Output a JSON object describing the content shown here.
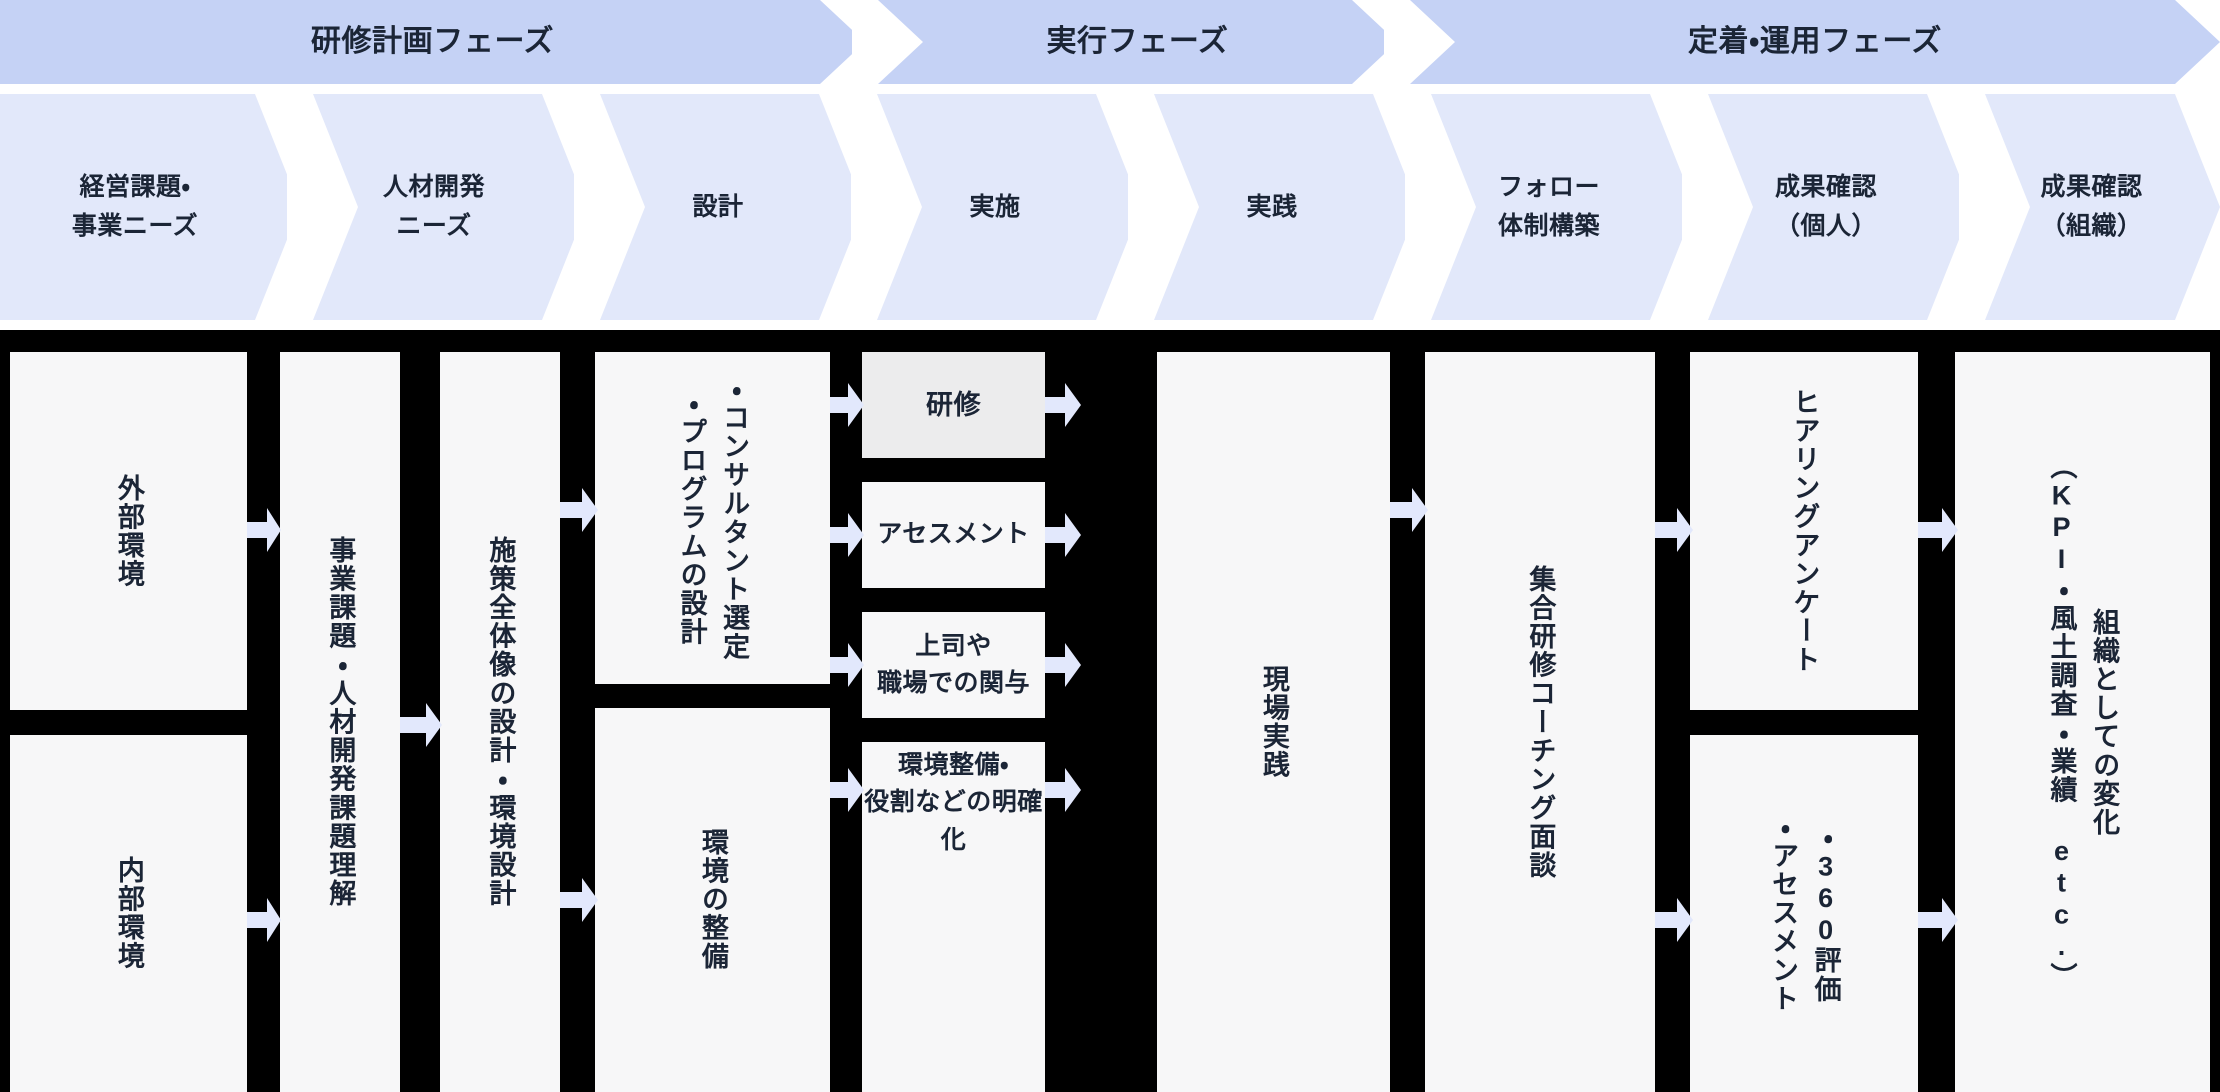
{
  "colors": {
    "phase_fill": "#c5d2f5",
    "stage_fill": "#e2e8fa",
    "separator": "#ffffff",
    "box_fill": "#f7f7f8",
    "box_fill_shaded": "#ececed",
    "body_background": "#000000",
    "arrow_fill": "#e2e8fc",
    "text": "#1b2536"
  },
  "phases": [
    {
      "label": "研修計画フェーズ"
    },
    {
      "label": "実行フェーズ"
    },
    {
      "label": "定着・運用フェーズ"
    }
  ],
  "stages": [
    {
      "label": "経営課題・\n事業ニーズ"
    },
    {
      "label": "人材開発\nニーズ"
    },
    {
      "label": "設計"
    },
    {
      "label": "実施"
    },
    {
      "label": "実践"
    },
    {
      "label": "フォロー\n体制構築"
    },
    {
      "label": "成果確認\n（個人）"
    },
    {
      "label": "成果確認\n（組織）"
    }
  ],
  "columns": [
    {
      "name": "environment",
      "boxes": [
        {
          "label": "外部環境",
          "orientation": "vertical",
          "shaded": false
        },
        {
          "label": "内部環境",
          "orientation": "vertical",
          "shaded": false
        }
      ]
    },
    {
      "name": "issue-understanding",
      "boxes": [
        {
          "label": "事業課題・人材開発課題理解",
          "orientation": "vertical",
          "shaded": false
        }
      ]
    },
    {
      "name": "overall-design",
      "boxes": [
        {
          "label": "施策全体像の設計・環境設計",
          "orientation": "vertical",
          "shaded": false
        }
      ]
    },
    {
      "name": "design-detail",
      "boxes": [
        {
          "label": "・コンサルタント選定\n・プログラムの設計",
          "orientation": "vertical",
          "shaded": false
        },
        {
          "label": "環境の整備",
          "orientation": "vertical",
          "shaded": false
        }
      ]
    },
    {
      "name": "implementation",
      "boxes": [
        {
          "label": "研修",
          "orientation": "horizontal",
          "shaded": true
        },
        {
          "label": "アセスメント",
          "orientation": "horizontal",
          "shaded": false
        },
        {
          "label": "上司や\n職場での関与",
          "orientation": "horizontal",
          "shaded": false
        },
        {
          "label": "環境整備・\n役割などの明確化",
          "orientation": "horizontal",
          "shaded": false
        }
      ]
    },
    {
      "name": "practice",
      "boxes": [
        {
          "label": "現場実践",
          "orientation": "vertical",
          "shaded": false
        }
      ]
    },
    {
      "name": "follow-up",
      "boxes": [
        {
          "label": "集合研修コーチング面談",
          "orientation": "vertical",
          "shaded": false
        }
      ]
    },
    {
      "name": "individual-results",
      "boxes": [
        {
          "label": "ヒアリングアンケート",
          "orientation": "vertical",
          "shaded": false
        },
        {
          "label": "・360評価\n・アセスメント",
          "orientation": "vertical",
          "shaded": false
        }
      ]
    },
    {
      "name": "organization-results",
      "boxes": [
        {
          "label": "組織としての変化\n（KPI・風土調査・業績 etc.）",
          "orientation": "vertical",
          "shaded": false
        }
      ]
    }
  ]
}
